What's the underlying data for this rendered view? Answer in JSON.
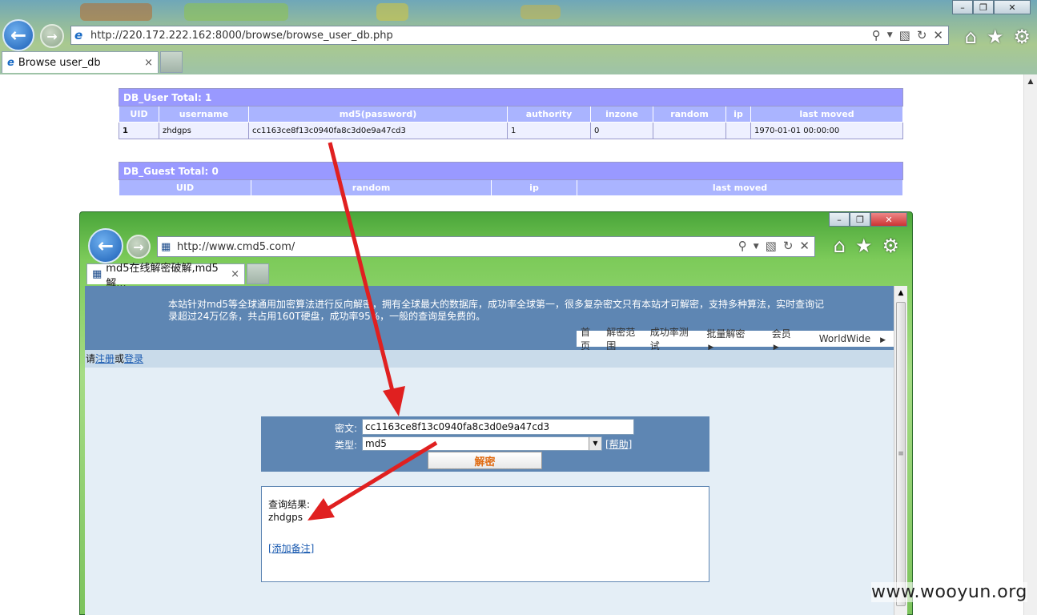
{
  "outer_browser": {
    "url": "http://220.172.222.162:8000/browse/browse_user_db.php",
    "tab_title": "Browse user_db",
    "tab_close": "×",
    "window_buttons": {
      "minimize": "–",
      "maximize": "❐",
      "close": "✕"
    },
    "icons": [
      "ie-logo-icon",
      "search-icon",
      "compat-icon",
      "refresh-icon",
      "stop-icon",
      "home-icon",
      "favorites-icon",
      "settings-icon"
    ]
  },
  "db_user": {
    "caption": "DB_User Total: 1",
    "columns": [
      "UID",
      "username",
      "md5(password)",
      "authority",
      "inzone",
      "random",
      "ip",
      "last moved"
    ],
    "rows": [
      [
        "1",
        "zhdgps",
        "cc1163ce8f13c0940fa8c3d0e9a47cd3",
        "1",
        "0",
        "",
        "",
        "1970-01-01 00:00:00"
      ]
    ]
  },
  "db_guest": {
    "caption": "DB_Guest Total: 0",
    "columns": [
      "UID",
      "random",
      "ip",
      "last moved"
    ]
  },
  "inner_browser": {
    "url": "http://www.cmd5.com/",
    "tab_title": "md5在线解密破解,md5解...",
    "tab_close": "×",
    "window_buttons": {
      "minimize": "–",
      "maximize": "❐",
      "close": "✕"
    }
  },
  "cmd5": {
    "description": "本站针对md5等全球通用加密算法进行反向解密，拥有全球最大的数据库，成功率全球第一，很多复杂密文只有本站才可解密，支持多种算法，实时查询记录超过24万亿条，共占用160T硬盘，成功率95%，一般的查询是免费的。",
    "menu": [
      "首页",
      "解密范围",
      "成功率测试",
      "批量解密",
      "会员",
      "WorldWide"
    ],
    "login_prefix": "请",
    "register": "注册",
    "or": "或",
    "login": "登录",
    "cipher_label": "密文:",
    "cipher_value": "cc1163ce8f13c0940fa8c3d0e9a47cd3",
    "type_label": "类型:",
    "type_value": "md5",
    "help": "[帮助]",
    "decrypt_button": "解密",
    "result_title": "查询结果:",
    "result_value": "zhdgps",
    "add_note": "[添加备注]"
  },
  "watermark": "www.wooyun.org",
  "colors": {
    "table_header": "#9999ff",
    "banner": "#5e86b3",
    "arrow": "#e02020",
    "button_text": "#e06a10"
  }
}
